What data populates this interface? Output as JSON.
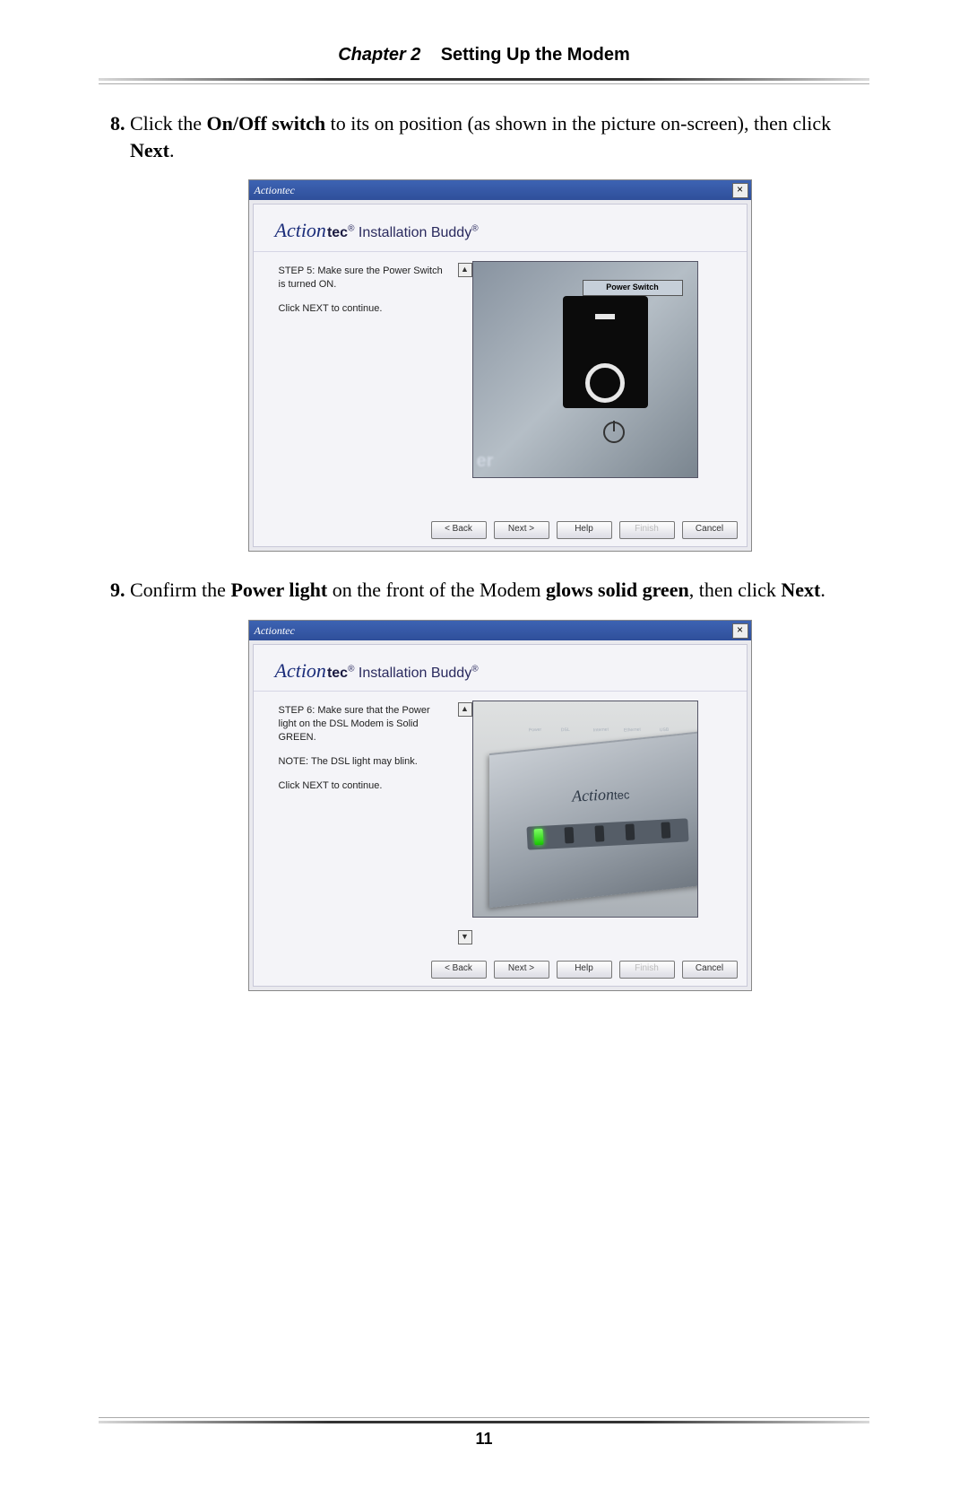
{
  "header": {
    "chapter_prefix": "Chapter 2",
    "title": "Setting Up the Modem"
  },
  "steps": {
    "s8": {
      "num": "8.",
      "pre": "Click the ",
      "b1": "On/Off switch",
      "mid": " to its on position (as shown in the picture on-screen), then click ",
      "b2": "Next",
      "post": "."
    },
    "s9": {
      "num": "9.",
      "pre": "Confirm the ",
      "b1": "Power light",
      "mid1": " on the front of the Modem ",
      "b2": "glows solid green",
      "mid2": ", then click ",
      "b3": "Next",
      "post": "."
    }
  },
  "app": {
    "brand_chip": "Actiontec",
    "logo_script": "Action",
    "logo_tec": "tec",
    "reg": "®",
    "install_buddy": " Installation Buddy",
    "close": "×",
    "scroll_up": "▲",
    "scroll_down": "▼",
    "buttons": {
      "back": "< Back",
      "next": "Next >",
      "help": "Help",
      "finish": "Finish",
      "cancel": "Cancel"
    },
    "win1": {
      "step": "STEP 5: Make sure the Power Switch is turned ON.",
      "click": "Click NEXT to continue.",
      "switch_label": "Power Switch",
      "er": "er"
    },
    "win2": {
      "step": "STEP 6: Make sure that the Power light on the DSL Modem is Solid GREEN.",
      "note": "NOTE: The DSL light may blink.",
      "click": "Click NEXT to continue.",
      "brand_script": "Action",
      "brand_tec": "tec",
      "led_lbls": {
        "a": "Power",
        "b": "DSL",
        "c": "Internet",
        "d": "Ethernet",
        "e": "USB"
      }
    }
  },
  "footer": {
    "page_number": "11"
  }
}
